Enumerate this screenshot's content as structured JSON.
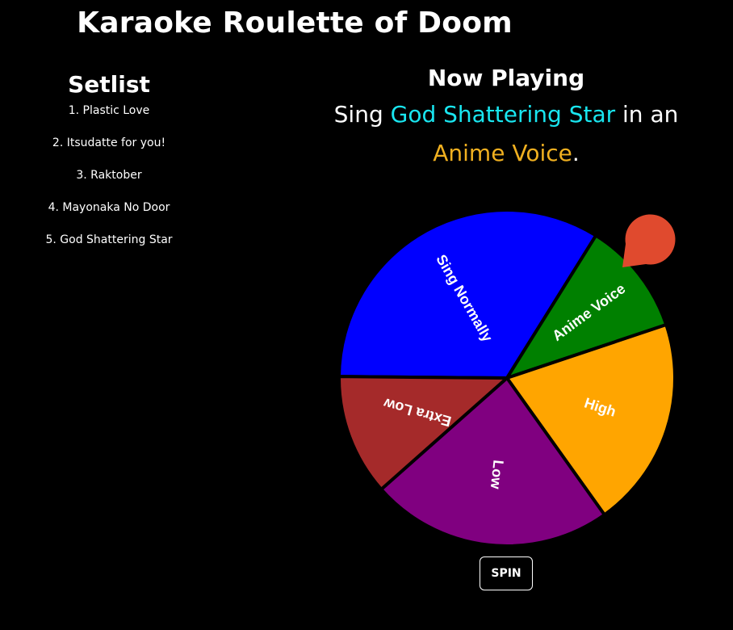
{
  "page": {
    "title": "Karaoke Roulette of Doom"
  },
  "setlist": {
    "heading": "Setlist",
    "items": [
      "1. Plastic Love",
      "2. Itsudatte for you!",
      "3. Raktober",
      "4. Mayonaka No Door",
      "5. God Shattering Star"
    ]
  },
  "now_playing": {
    "heading": "Now Playing",
    "prefix": "Sing ",
    "song": "God Shattering Star",
    "middle": " in an",
    "voice": "Anime Voice",
    "suffix": ".",
    "song_color": "#19e6f0",
    "voice_color": "#f0b020"
  },
  "wheel": {
    "segments": [
      {
        "label": "Sing Normally",
        "color": "#0000ff"
      },
      {
        "label": "Anime Voice",
        "color": "#008000"
      },
      {
        "label": "High",
        "color": "#ffa500"
      },
      {
        "label": "Low",
        "color": "#800080"
      },
      {
        "label": "Extra Low",
        "color": "#a52a2a"
      }
    ],
    "pointer_color": "#e04a2e"
  },
  "controls": {
    "spin_label": "SPIN"
  }
}
